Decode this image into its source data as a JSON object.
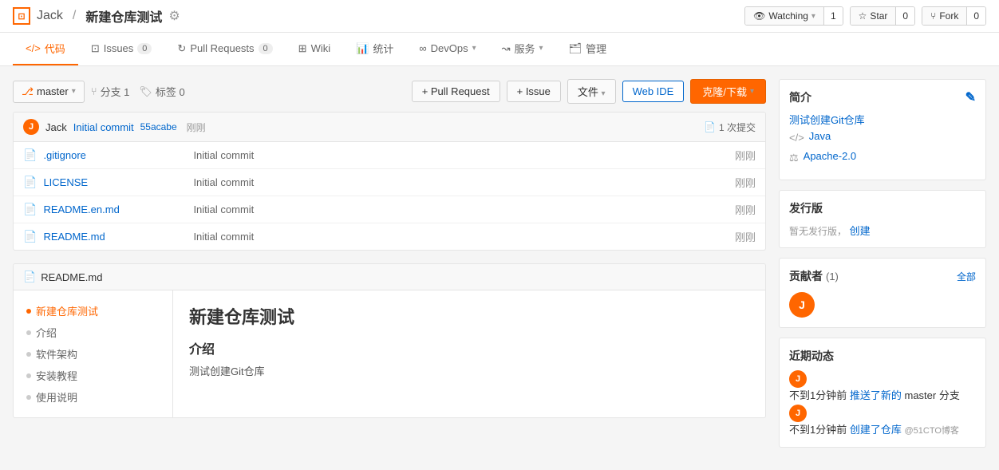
{
  "header": {
    "repo_icon": "[]",
    "owner": "Jack",
    "slash": "/",
    "repo_name": "新建仓库测试",
    "settings_icon": "⚙",
    "watching_label": "Watching",
    "watching_count": "1",
    "star_label": "Star",
    "star_count": "0",
    "fork_label": "Fork",
    "fork_count": "0"
  },
  "nav": {
    "tabs": [
      {
        "id": "code",
        "icon": "</>",
        "label": "代码",
        "badge": null,
        "active": true
      },
      {
        "id": "issues",
        "icon": "⊡",
        "label": "Issues",
        "badge": "0",
        "active": false
      },
      {
        "id": "pullrequests",
        "icon": "↻",
        "label": "Pull Requests",
        "badge": "0",
        "active": false
      },
      {
        "id": "wiki",
        "icon": "⊞",
        "label": "Wiki",
        "badge": null,
        "active": false
      },
      {
        "id": "stats",
        "icon": "📊",
        "label": "统计",
        "badge": null,
        "active": false
      },
      {
        "id": "devops",
        "icon": "∞",
        "label": "DevOps",
        "badge": null,
        "active": false,
        "dropdown": true
      },
      {
        "id": "services",
        "icon": "↝",
        "label": "服务",
        "badge": null,
        "active": false,
        "dropdown": true
      },
      {
        "id": "manage",
        "icon": "🗂",
        "label": "管理",
        "badge": null,
        "active": false
      }
    ]
  },
  "toolbar": {
    "branch_name": "master",
    "branches_label": "分支 1",
    "tags_label": "标签 0",
    "pull_request_btn": "+ Pull Request",
    "issue_btn": "+ Issue",
    "file_btn": "文件",
    "webide_btn": "Web IDE",
    "clone_btn": "克隆/下载"
  },
  "commit_info": {
    "avatar_letter": "J",
    "author": "Jack",
    "message": "Initial commit",
    "hash": "55acabe",
    "time": "刚刚",
    "count_label": "1 次提交"
  },
  "files": [
    {
      "name": ".gitignore",
      "commit": "Initial commit",
      "time": "刚刚"
    },
    {
      "name": "LICENSE",
      "commit": "Initial commit",
      "time": "刚刚"
    },
    {
      "name": "README.en.md",
      "commit": "Initial commit",
      "time": "刚刚"
    },
    {
      "name": "README.md",
      "commit": "Initial commit",
      "time": "刚刚"
    }
  ],
  "readme": {
    "title": "README.md",
    "toc": [
      {
        "label": "新建仓库测试",
        "active": true
      },
      {
        "label": "介绍",
        "active": false
      },
      {
        "label": "软件架构",
        "active": false
      },
      {
        "label": "安装教程",
        "active": false
      },
      {
        "label": "使用说明",
        "active": false
      }
    ],
    "content_h1": "新建仓库测试",
    "content_h2": "介绍",
    "content_p": "测试创建Git仓库"
  },
  "sidebar": {
    "intro_title": "简介",
    "edit_icon": "✎",
    "intro_link": "测试创建Git仓库",
    "lang_icon": "</>",
    "lang_label": "Java",
    "license_icon": "⚖",
    "license_label": "Apache-2.0",
    "releases_title": "发行版",
    "no_release": "暂无发行版，",
    "create_link": "创建",
    "contributors_title": "贡献者",
    "contributors_count": "(1)",
    "all_label": "全部",
    "contributor_letter": "J",
    "activity_title": "近期动态",
    "activities": [
      {
        "avatar_letter": "J",
        "text_before": "不到1分钟前",
        "link_text": "推送了新的",
        "text_after": "master 分支",
        "at_user": ""
      },
      {
        "avatar_letter": "J",
        "text_before": "不到1分钟前",
        "link_text": "创建了仓库",
        "text_after": "",
        "at_user": "@51CTO博客"
      }
    ]
  }
}
